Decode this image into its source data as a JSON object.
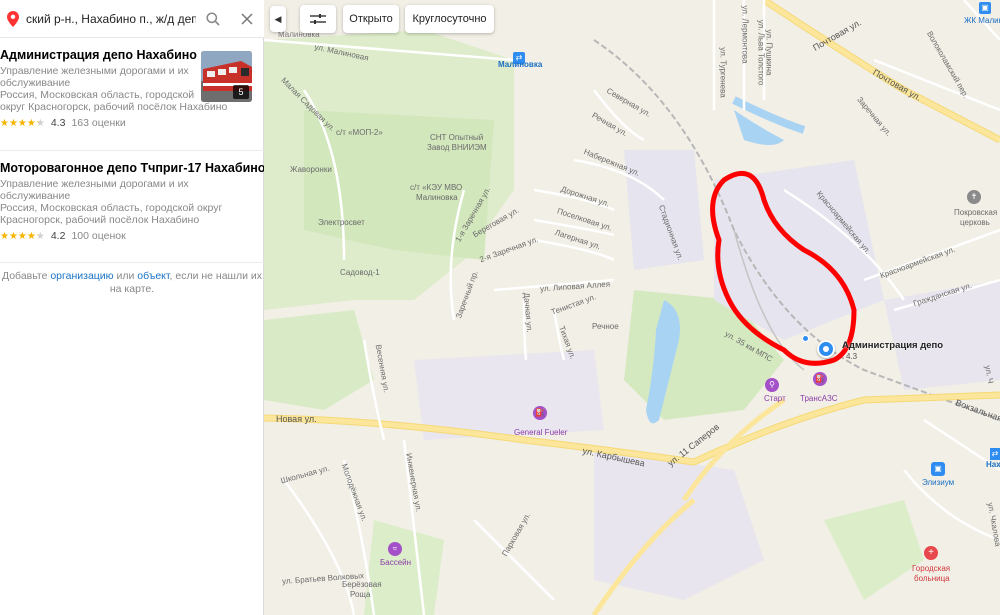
{
  "search": {
    "query": "ский р-н., Нахабино п., ж/д депо"
  },
  "results": [
    {
      "title": "Администрация депо Нахабино",
      "category_line1": "Управление железными дорогами и их",
      "category_line2": "обслуживание",
      "address_line1": "Россия, Московская область, городской",
      "address_line2": "округ Красногорск, рабочий посёлок Нахабино",
      "rating": 4.3,
      "rating_text": "4.3",
      "reviews": "163 оценки",
      "photo_count": "5"
    },
    {
      "title": "Моторовагонное депо Тчприг-17 Нахабино",
      "category_line1": "Управление железными дорогами и их",
      "category_line2": "обслуживание",
      "address_line1": "Россия, Московская область, городской округ",
      "address_line2": "Красногорск, рабочий посёлок Нахабино",
      "rating": 4.2,
      "rating_text": "4.2",
      "reviews": "100 оценок"
    }
  ],
  "add_note": {
    "prefix": "Добавьте ",
    "org_link": "организацию",
    "middle": " или ",
    "obj_link": "объект",
    "suffix": ", если не нашли их на карте."
  },
  "map_controls": {
    "chip_open": "Открыто",
    "chip_24h": "Круглосуточно"
  },
  "map_labels": {
    "malinovka_top": "Малиновка",
    "malinovka_station": "Малиновка",
    "malinovka_ul": "ул. Малиновая",
    "malaya_sadovaya": "Малая Садовая ул.",
    "smop2": "с/т «МОП-2»",
    "snt": "СНТ Опытный",
    "snt2": "Завод ВНИИЭМ",
    "zhavoronki": "Жаворонки",
    "kzu": "с/т «КЭУ МВО",
    "kzu2": "Малиновка",
    "elektrosvet": "Электросвет",
    "sadovod": "Садовод-1",
    "severnaya": "Северная ул.",
    "rechnaya": "Речная ул.",
    "naberezhnaya": "Набережная ул.",
    "dorozhnaya": "Дорожная ул.",
    "poselkovaya": "Поселковая ул.",
    "lagernaya": "Лагерная ул.",
    "lipovaya": "ул. Липовая Аллея",
    "tenistaya": "Тенистая ул.",
    "tihaya": "Тихая ул.",
    "dachnaya": "Дачная ул.",
    "rechnoe": "Речное",
    "zarechnaya1": "1-я Заречная ул.",
    "zarechnaya2": "2-я Заречная ул.",
    "beregovaya": "Береговая ул.",
    "zarechny": "Заречный пр.",
    "stadionnaya": "Стадионная ул.",
    "turgeneva": "ул. Тургенева",
    "lermontova": "ул. Лермонтова",
    "tolstogo": "ул. Льва Толстого",
    "pushkina": "ул. Пушкина",
    "pochtovaya": "Почтовая ул.",
    "pochtovaya2": "Почтовая ул.",
    "volokolamsky": "Волоколамский пер.",
    "zarechnaya_right": "Заречная ул.",
    "krasnoarm_ul": "Красноармейская ул.",
    "krasnoarm_ul2": "Красноармейская ул.",
    "grazhdanskaya": "Гражданская ул.",
    "pokrovskaya": "Покровская",
    "pokrovskaya2": "церковь",
    "zhk": "ЖК Малина",
    "ul35km": "ул. 35 км МПС",
    "admin_depo": "Администрация депо",
    "admin_rating": "4.3",
    "start": "Старт",
    "transazs": "ТрансАЗС",
    "general_fueler": "General Fueler",
    "novaya": "Новая ул.",
    "karbysheva": "ул. Карбышева",
    "ul11saperov": "ул. 11 Саперов",
    "vokzalnaya": "Вокзальная ул.",
    "nakhabino": "Нах",
    "elizium": "Элизиум",
    "shkolnaya": "Школьная ул.",
    "molodezhnaya": "Молодёжная ул.",
    "inzhenernaya": "Инженерная ул.",
    "vesennyaya": "Весенняя ул.",
    "bratev": "ул. Братьев Волковых",
    "parkovaya": "Парковая ул.",
    "bassein": "Бассейн",
    "berezovaya": "Берёзовая",
    "berezovaya2": "Роща",
    "gorodskaya": "Городская",
    "gorodskaya2": "больница",
    "chkalova": "ул. Чкалова",
    "ul_top_right": "ул. Ч"
  },
  "colors": {
    "map_bg": "#f2efe6",
    "forest": "#d9ecc4",
    "water": "#a9d3f2",
    "road_major": "#fbe69b",
    "road_minor": "#ffffff",
    "highlight_red": "#ff0000",
    "link_blue": "#1a73c6",
    "star_yellow": "#f6b400",
    "poi_purple": "#a450c8",
    "pin_blue": "#2f8cf0"
  }
}
